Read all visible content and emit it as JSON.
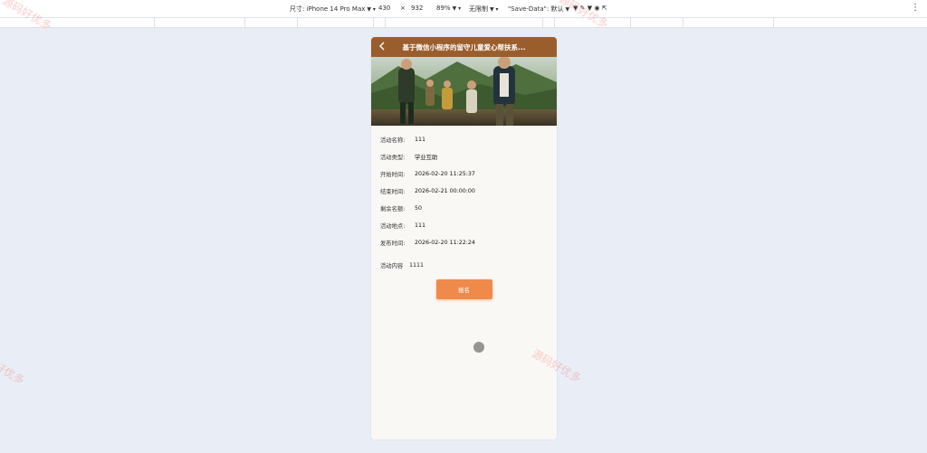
{
  "devtools": {
    "size_label": "尺寸: iPhone 14 Pro Max",
    "width": "430",
    "times": "×",
    "height": "932",
    "zoom": "89%",
    "throttle": "无限制",
    "save_data": "\"Save-Data\": 默认"
  },
  "nav": {
    "title": "基于微信小程序的留守儿童爱心帮扶系..."
  },
  "activity": {
    "rows": [
      {
        "label": "活动名称:",
        "value": "111"
      },
      {
        "label": "活动类型:",
        "value": "学业互助"
      },
      {
        "label": "开始时间:",
        "value": "2026-02-20 11:25:37"
      },
      {
        "label": "结束时间:",
        "value": "2026-02-21 00:00:00"
      },
      {
        "label": "剩余名额:",
        "value": "50"
      },
      {
        "label": "活动地点:",
        "value": "111"
      },
      {
        "label": "发布时间:",
        "value": "2026-02-20 11:22:24"
      }
    ],
    "content_label": "活动内容",
    "content_value": "1111",
    "signup_label": "报名"
  },
  "watermark": "源码好优多",
  "colors": {
    "nav_bg": "#9a5e2c",
    "button": "#f08a4b",
    "page_bg": "#e9eef6"
  }
}
